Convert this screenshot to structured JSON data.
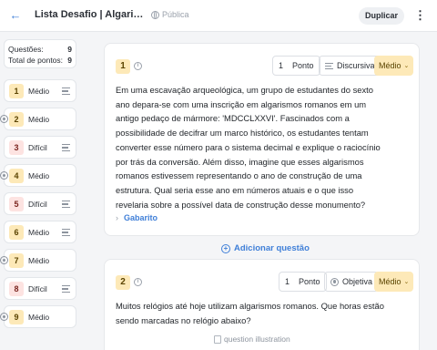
{
  "header": {
    "back_icon": "arrow-left-icon",
    "title": "Lista Desafio | Algarismos Romanos",
    "visibility": "Pública",
    "duplicate_label": "Duplicar",
    "more_icon": "kebab-icon"
  },
  "summary": {
    "questions_label": "Questões:",
    "questions_count": "9",
    "points_label": "Total de pontos:",
    "points_count": "9"
  },
  "sidebar": {
    "items": [
      {
        "num": "1",
        "label": "Médio",
        "level": "medio",
        "type": "discursive"
      },
      {
        "num": "2",
        "label": "Médio",
        "level": "medio",
        "type": "objective"
      },
      {
        "num": "3",
        "label": "Difícil",
        "level": "dificil",
        "type": "discursive"
      },
      {
        "num": "4",
        "label": "Médio",
        "level": "medio",
        "type": "objective"
      },
      {
        "num": "5",
        "label": "Difícil",
        "level": "dificil",
        "type": "discursive"
      },
      {
        "num": "6",
        "label": "Médio",
        "level": "medio",
        "type": "discursive"
      },
      {
        "num": "7",
        "label": "Médio",
        "level": "medio",
        "type": "objective"
      },
      {
        "num": "8",
        "label": "Difícil",
        "level": "dificil",
        "type": "discursive"
      },
      {
        "num": "9",
        "label": "Médio",
        "level": "medio",
        "type": "objective"
      }
    ]
  },
  "question1": {
    "num": "1",
    "points_value": "1",
    "points_unit": "Ponto",
    "type_label": "Discursiva",
    "difficulty": "Médio",
    "text": "Em uma escavação arqueológica, um grupo de estudantes do sexto ano depara-se com uma inscrição em algarismos romanos em um antigo pedaço de mármore: 'MDCCLXXVI'. Fascinados com a possibilidade de decifrar um marco histórico, os estudantes tentam converter esse número para o sistema decimal e explique o raciocínio por trás da conversão. Além disso, imagine que esses algarismos romanos estivessem representando o ano de construção de uma estrutura. Qual seria esse ano em números atuais e o que isso revelaria sobre a possível data de construção desse monumento?",
    "answer_label": "Gabarito"
  },
  "add_question_label": "Adicionar questão",
  "question2": {
    "num": "2",
    "points_value": "1",
    "points_unit": "Ponto",
    "type_label": "Objetiva",
    "difficulty": "Médio",
    "text": "Muitos relógios até hoje utilizam algarismos romanos. Que horas estão sendo marcadas no relógio abaixo?",
    "image_alt": "question illustration"
  },
  "colors": {
    "accent": "#3f7fd8",
    "medium_badge": "#fde9b8",
    "hard_badge": "#fde3e1"
  }
}
